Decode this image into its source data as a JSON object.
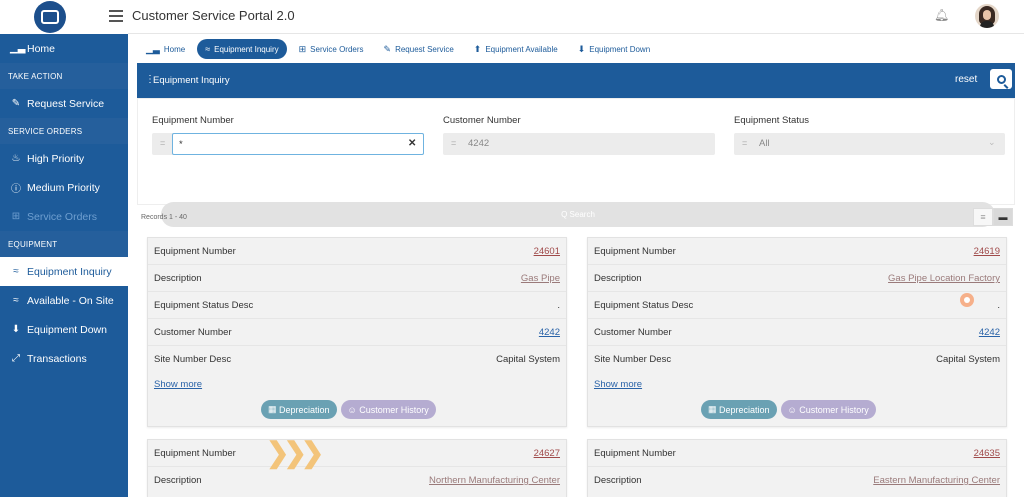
{
  "app": {
    "title": "Customer Service Portal 2.0"
  },
  "sidebar": {
    "items": [
      {
        "label": "Home",
        "icon": "chart-icon"
      },
      {
        "section": "TAKE ACTION"
      },
      {
        "label": "Request Service",
        "icon": "pencil-icon"
      },
      {
        "section": "SERVICE ORDERS"
      },
      {
        "label": "High Priority",
        "icon": "flame-icon"
      },
      {
        "label": "Medium Priority",
        "icon": "info-circle-icon"
      },
      {
        "label": "Service Orders",
        "icon": "grid-icon"
      },
      {
        "section": "EQUIPMENT"
      },
      {
        "label": "Equipment Inquiry",
        "icon": "layers-icon"
      },
      {
        "label": "Available - On Site",
        "icon": "layers-icon"
      },
      {
        "label": "Equipment Down",
        "icon": "arrow-down-circle-icon"
      },
      {
        "label": "Transactions",
        "icon": "expand-icon"
      }
    ]
  },
  "tabs": [
    {
      "label": "Home"
    },
    {
      "label": "Equipment Inquiry"
    },
    {
      "label": "Service Orders"
    },
    {
      "label": "Request Service"
    },
    {
      "label": "Equipment Available"
    },
    {
      "label": "Equipment Down"
    }
  ],
  "panel": {
    "title": "Equipment Inquiry",
    "reset": "reset"
  },
  "form": {
    "equipment_number": {
      "label": "Equipment Number",
      "op": "=",
      "value": "*"
    },
    "customer_number": {
      "label": "Customer Number",
      "op": "=",
      "value": "4242"
    },
    "equipment_status": {
      "label": "Equipment Status",
      "op": "=",
      "value": "All"
    },
    "search_label": "Q Search"
  },
  "records_label": "Records 1 - 40",
  "cards": [
    {
      "rows": [
        {
          "k": "Equipment Number",
          "v": "24601"
        },
        {
          "k": "Description",
          "v": "Gas Pipe"
        },
        {
          "k": "Equipment Status Desc",
          "v": "."
        },
        {
          "k": "Customer Number",
          "v": "4242"
        },
        {
          "k": "Site Number Desc",
          "v": "Capital System"
        }
      ],
      "show_more": "Show more",
      "depreciation": "Depreciation",
      "history": "Customer History"
    },
    {
      "rows": [
        {
          "k": "Equipment Number",
          "v": "24619"
        },
        {
          "k": "Description",
          "v": "Gas Pipe Location Factory"
        },
        {
          "k": "Equipment Status Desc",
          "v": "."
        },
        {
          "k": "Customer Number",
          "v": "4242"
        },
        {
          "k": "Site Number Desc",
          "v": "Capital System"
        }
      ],
      "show_more": "Show more",
      "depreciation": "Depreciation",
      "history": "Customer History"
    },
    {
      "rows": [
        {
          "k": "Equipment Number",
          "v": "24627"
        },
        {
          "k": "Description",
          "v": "Northern Manufacturing Center"
        }
      ]
    },
    {
      "rows": [
        {
          "k": "Equipment Number",
          "v": "24635"
        },
        {
          "k": "Description",
          "v": "Eastern Manufacturing Center"
        }
      ]
    }
  ],
  "colors": {
    "primary": "#1d5b9a",
    "teal": "#6aa1b3",
    "lavender": "#b5acd1"
  }
}
